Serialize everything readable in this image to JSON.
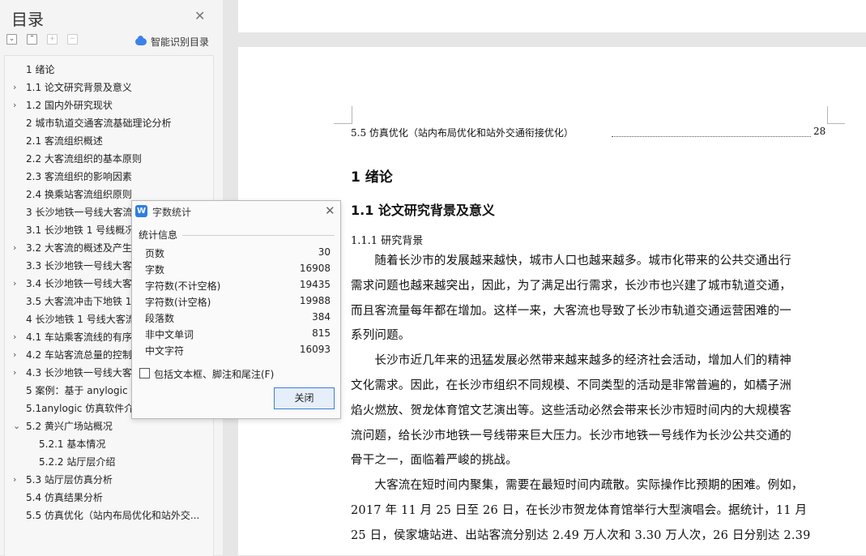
{
  "toc": {
    "title": "目录",
    "smart_label": "智能识别目录",
    "items": [
      {
        "label": "1 绪论",
        "arrow": ""
      },
      {
        "label": "1.1 论文研究背景及意义",
        "arrow": "›"
      },
      {
        "label": "1.2 国内外研究现状",
        "arrow": "›"
      },
      {
        "label": "2 城市轨道交通客流基础理论分析",
        "arrow": ""
      },
      {
        "label": "2.1 客流组织概述",
        "arrow": ""
      },
      {
        "label": "2.2 大客流组织的基本原则",
        "arrow": ""
      },
      {
        "label": "2.3 客流组织的影响因素",
        "arrow": ""
      },
      {
        "label": "2.4 换乘站客流组织原则",
        "arrow": ""
      },
      {
        "label": "3 长沙地铁一号线大客流",
        "arrow": ""
      },
      {
        "label": "3.1 长沙地铁 1 号线概况",
        "arrow": ""
      },
      {
        "label": "3.2 大客流的概述及产生",
        "arrow": "›"
      },
      {
        "label": "3.3 长沙地铁一号线大客",
        "arrow": ""
      },
      {
        "label": "3.4 长沙地铁一号线大客",
        "arrow": "›"
      },
      {
        "label": "3.5 大客流冲击下地铁 1",
        "arrow": ""
      },
      {
        "label": "4 长沙地铁 1 号线大客流",
        "arrow": ""
      },
      {
        "label": "4.1 车站乘客流线的有序",
        "arrow": "›"
      },
      {
        "label": "4.2 车站客流总量的控制",
        "arrow": "›"
      },
      {
        "label": "4.3 长沙地铁一号线大客",
        "arrow": "›"
      },
      {
        "label": "5 案例：基于 anylogic 仿",
        "arrow": ""
      },
      {
        "label": "5.1anylogic 仿真软件介绍",
        "arrow": ""
      },
      {
        "label": "5.2 黄兴广场站概况",
        "arrow": "⌄"
      },
      {
        "label": "5.2.1 基本情况",
        "arrow": ""
      },
      {
        "label": "5.2.2 站厅层介绍",
        "arrow": ""
      },
      {
        "label": "5.3 站厅层仿真分析",
        "arrow": "›"
      },
      {
        "label": "5.4 仿真结果分析",
        "arrow": ""
      },
      {
        "label": "5.5 仿真优化（站内布局优化和站外交...",
        "arrow": ""
      }
    ]
  },
  "dialog": {
    "title": "字数统计",
    "section": "统计信息",
    "stats": [
      {
        "label": "页数",
        "value": "30"
      },
      {
        "label": "字数",
        "value": "16908"
      },
      {
        "label": "字符数(不计空格)",
        "value": "19435"
      },
      {
        "label": "字符数(计空格)",
        "value": "19988"
      },
      {
        "label": "段落数",
        "value": "384"
      },
      {
        "label": "非中文单词",
        "value": "815"
      },
      {
        "label": "中文字符",
        "value": "16093"
      }
    ],
    "checkbox_label": "包括文本框、脚注和尾注(F)",
    "close_label": "关闭"
  },
  "document": {
    "toc_line": {
      "text": "5.5 仿真优化（站内布局优化和站外交通衔接优化）",
      "page": "28"
    },
    "h1": "1 绪论",
    "h2": "1.1 论文研究背景及意义",
    "h3": "1.1.1 研究背景",
    "lines": [
      "　　随着长沙市的发展越来越快，城市人口也越来越多。城市化带来的公共交通出行",
      "需求问题也越来越突出，因此，为了满足出行需求，长沙市也兴建了城市轨道交通，",
      "而且客流量每年都在增加。这样一来，大客流也导致了长沙市轨道交通运营困难的一",
      "系列问题。",
      "　　长沙市近几年来的迅猛发展必然带来越来越多的经济社会活动，增加人们的精神",
      "文化需求。因此，在长沙市组织不同规模、不同类型的活动是非常普遍的，如橘子洲",
      "焰火燃放、贺龙体育馆文艺演出等。这些活动必然会带来长沙市短时间内的大规模客",
      "流问题，给长沙市地铁一号线带来巨大压力。长沙市地铁一号线作为长沙公共交通的",
      "骨干之一，面临着严峻的挑战。",
      "　　大客流在短时间内聚集，需要在最短时间内疏散。实际操作比预期的困难。例如，",
      "2017 年 11 月 25 日至 26 日，在长沙市贺龙体育馆举行大型演唱会。据统计，11 月",
      "25 日，侯家塘站进、出站客流分别达 2.49 万人次和 3.30 万人次，26 日分别达 2.39"
    ]
  }
}
